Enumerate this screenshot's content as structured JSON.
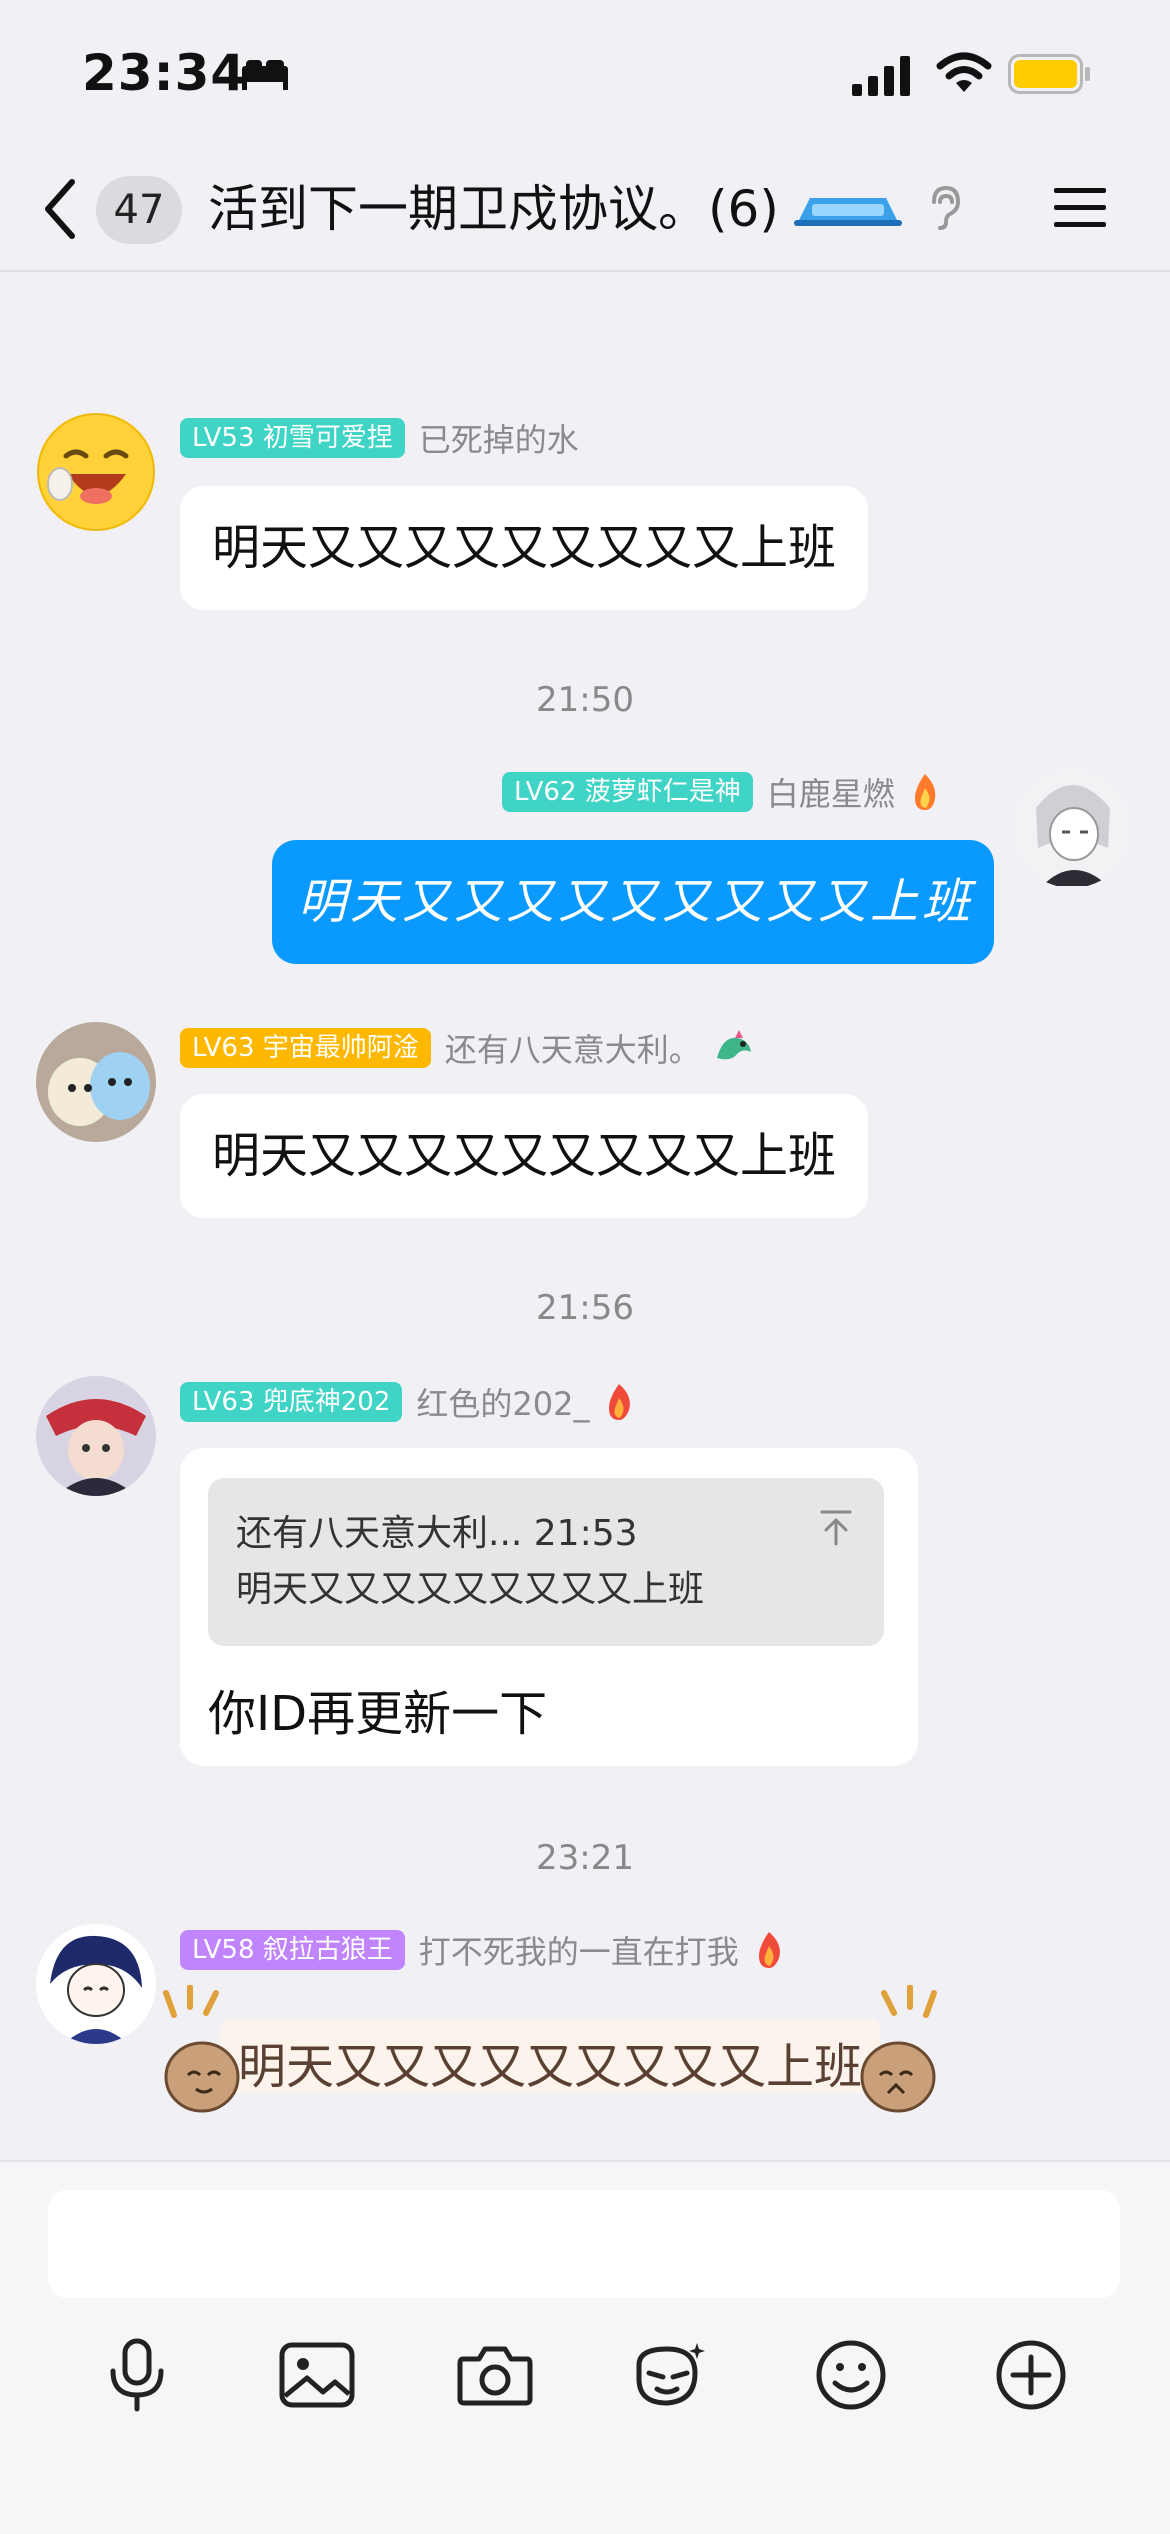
{
  "status_bar": {
    "time": "23:34",
    "icons": [
      "bed-icon",
      "signal-icon",
      "wifi-icon",
      "battery-icon"
    ],
    "battery_color": "#FFCC00"
  },
  "nav": {
    "back_icon": "chevron-left-icon",
    "unread_count": "47",
    "title": "活到下一期卫戍协议。(6)",
    "icons": [
      "group-tag-icon",
      "ear-icon",
      "menu-icon"
    ]
  },
  "messages": [
    {
      "level": "LV53 初雪可爱捏",
      "level_color": "#3FD4C6",
      "nickname": "已死掉的水",
      "text": "明天又又又又又又又又又上班"
    },
    {
      "time": "21:50"
    },
    {
      "level": "LV62 菠萝虾仁是神",
      "level_color": "#3FD4C6",
      "nickname": "白鹿星燃",
      "text": "明天又又又又又又又又又上班",
      "mine": true,
      "bubble_color": "#0A9AFF"
    },
    {
      "level": "LV63 宇宙最帅阿淦",
      "level_color": "#FFB800",
      "nickname": "还有八天意大利。",
      "text": "明天又又又又又又又又又上班"
    },
    {
      "time": "21:56"
    },
    {
      "level": "LV63 兜底神202",
      "level_color": "#3FD4C6",
      "nickname": "红色的202_",
      "quote_header": "还有八天意大利... 21:53",
      "quote_text": "明天又又又又又又又又又上班",
      "text": "你ID再更新一下"
    },
    {
      "time": "23:21"
    },
    {
      "level": "LV58 叙拉古狼王",
      "level_color": "#C084FC",
      "nickname": "打不死我的一直在打我",
      "text": "明天又又又又又又又又又上班"
    }
  ],
  "input": {
    "placeholder": "",
    "toolbar_icons": [
      "microphone-icon",
      "image-icon",
      "camera-icon",
      "sticker-icon",
      "emoji-icon",
      "plus-icon"
    ]
  }
}
